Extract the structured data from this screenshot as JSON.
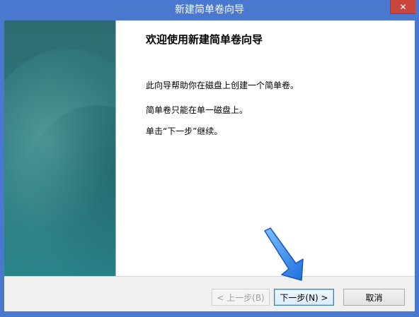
{
  "window": {
    "title": "新建简单卷向导"
  },
  "titlebar": {
    "close_glyph": "✕"
  },
  "wizard": {
    "heading": "欢迎使用新建简单卷向导",
    "paragraphs": [
      "此向导帮助你在磁盘上创建一个简单卷。",
      "简单卷只能在单一磁盘上。",
      "单击“下一步”继续。"
    ]
  },
  "buttons": {
    "back_label": "< 上一步(B)",
    "next_label": "下一步(N) >",
    "cancel_label": "取消"
  },
  "colors": {
    "titlebar": "#4a78cf",
    "close_button": "#c8463d",
    "side_panel": "#2f777a",
    "pointer_arrow": "#2f86f0"
  },
  "icons": {
    "close": "close-icon",
    "pointer": "arrow-pointer-icon"
  }
}
